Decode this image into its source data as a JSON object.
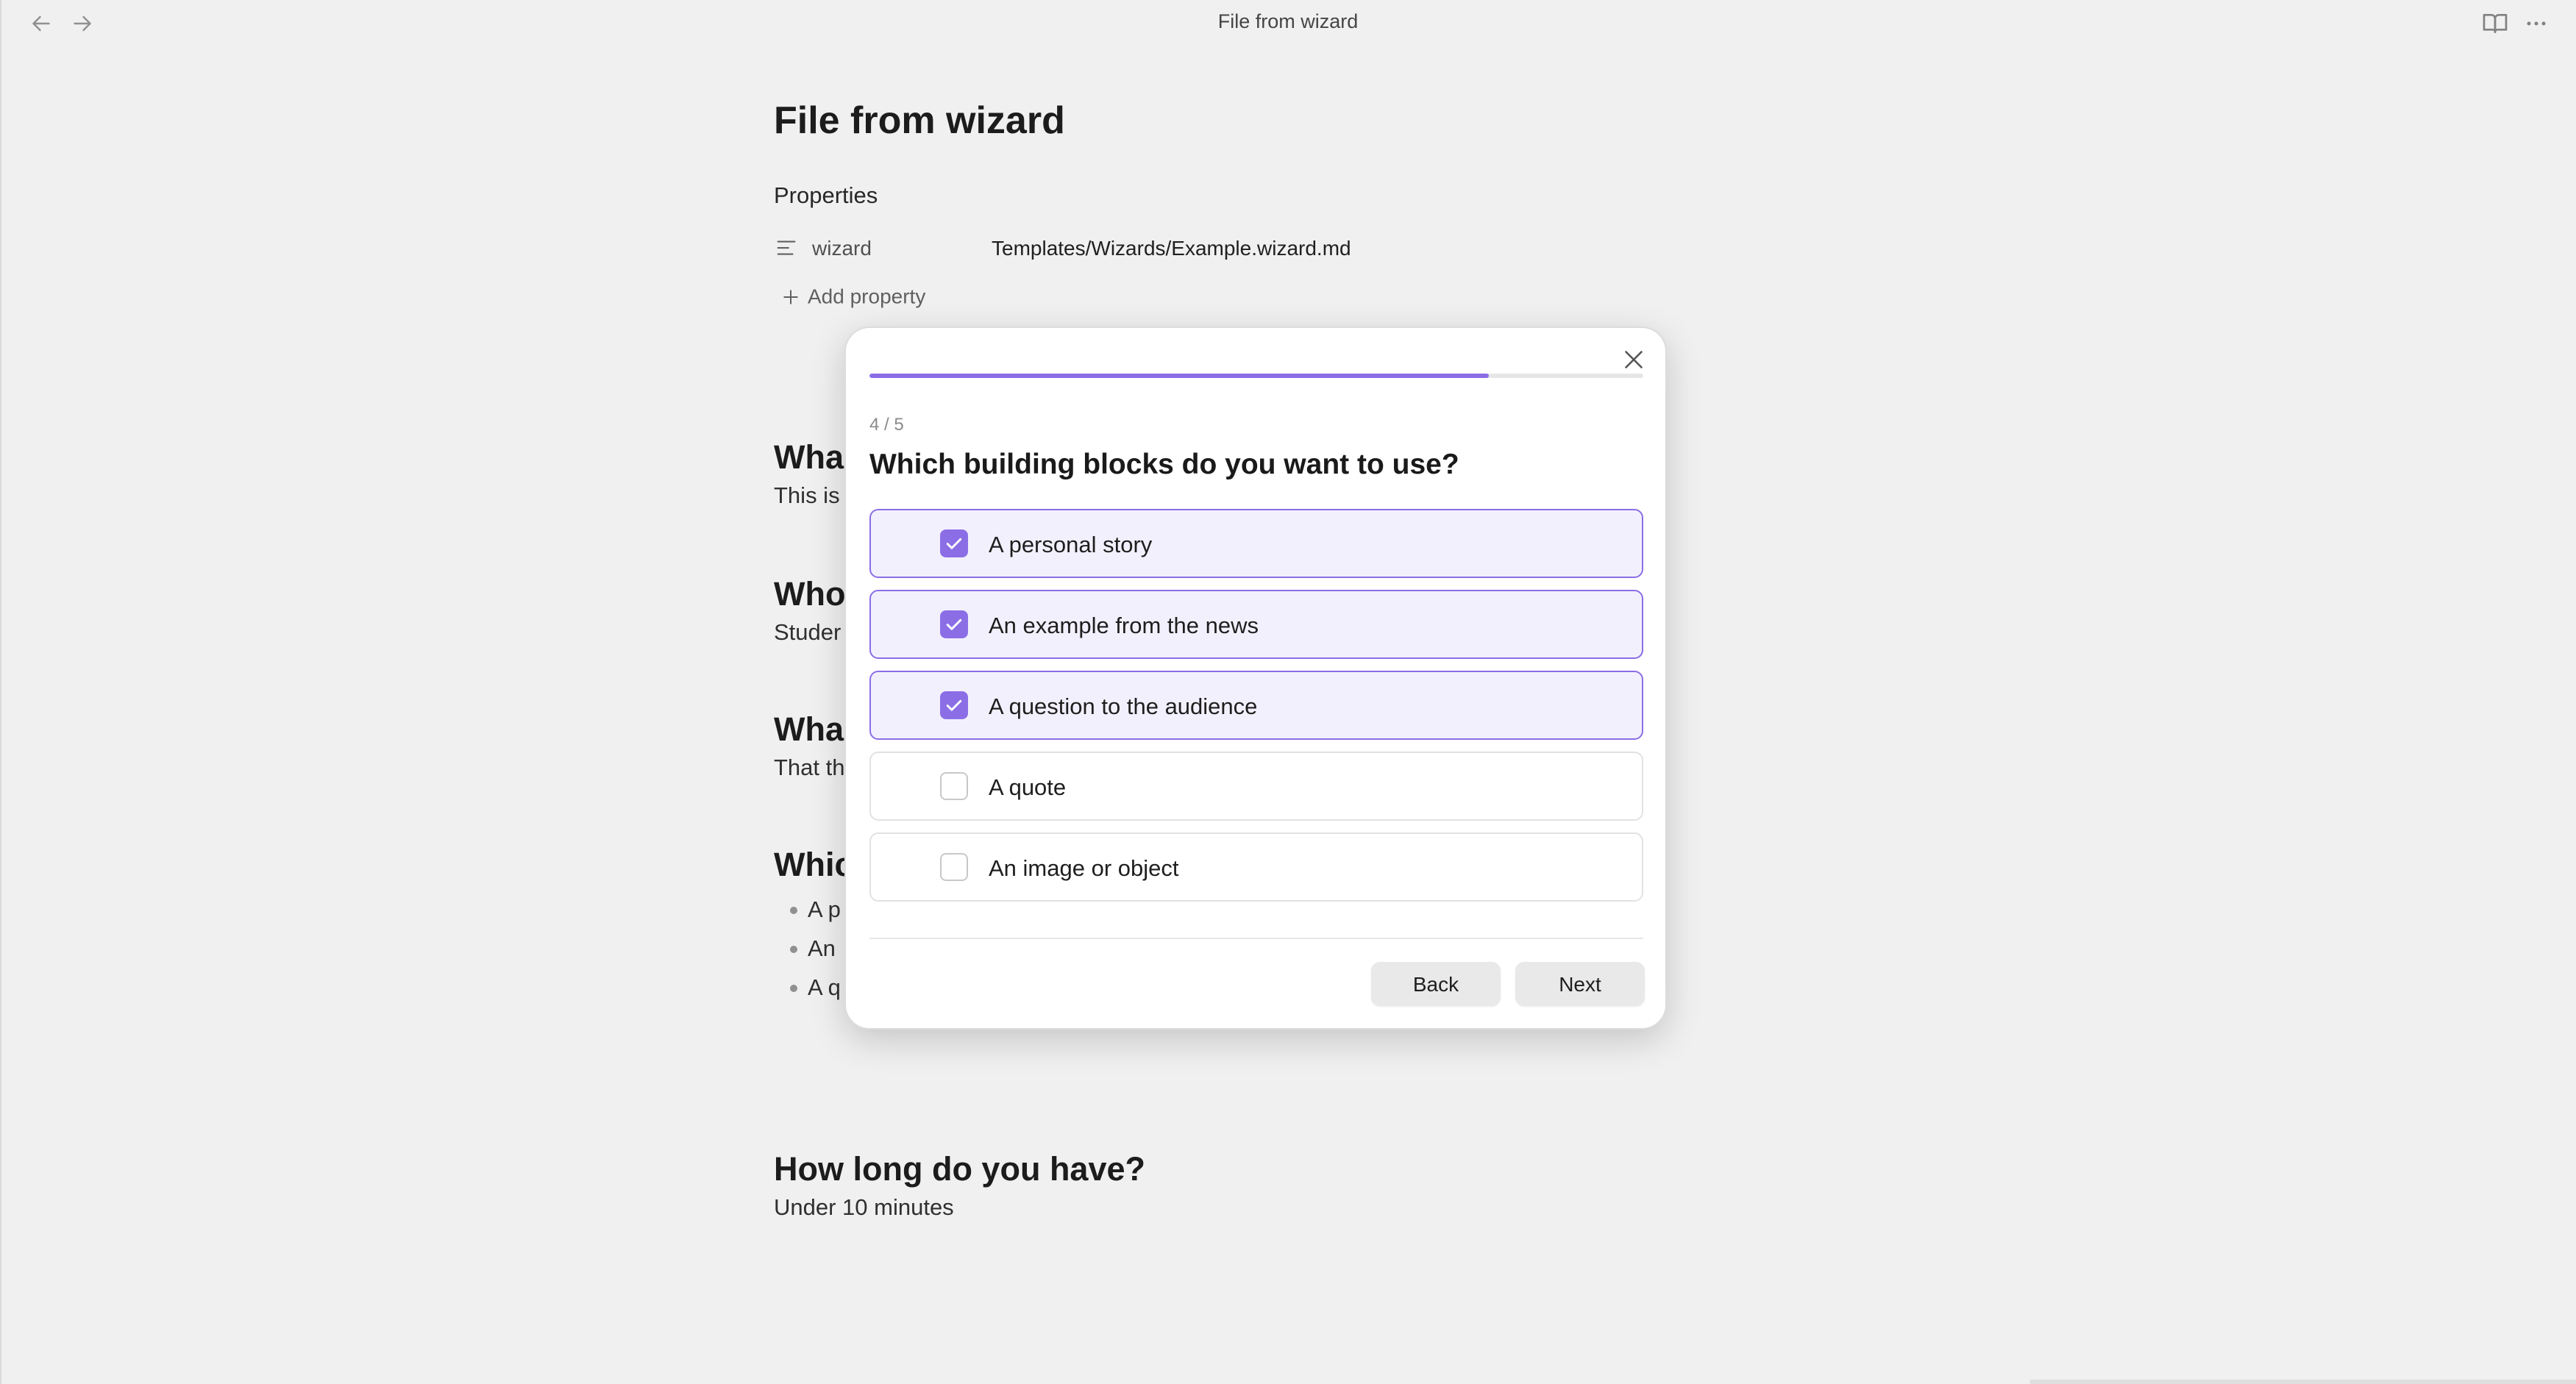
{
  "window": {
    "title": "File from wizard"
  },
  "icons": {
    "back": "arrow-left-icon",
    "forward": "arrow-right-icon",
    "reading_view": "book-open-icon",
    "more": "more-horizontal-icon",
    "property_type": "text-lines-icon",
    "add": "plus-icon",
    "close": "close-icon",
    "check": "check-icon"
  },
  "document": {
    "title": "File from wizard",
    "properties_heading": "Properties",
    "property": {
      "key": "wizard",
      "value": "Templates/Wizards/Example.wizard.md"
    },
    "add_property_label": "Add property",
    "sections": [
      {
        "heading": "Wha",
        "text": "This is"
      },
      {
        "heading": "Who",
        "text": "Studer"
      },
      {
        "heading": "Wha",
        "text": "That th"
      },
      {
        "heading": "Whic",
        "items": [
          "A p",
          "An",
          "A q"
        ]
      },
      {
        "heading": "How long do you have?",
        "text": "Under 10 minutes"
      }
    ]
  },
  "wizard": {
    "progress": {
      "current": 4,
      "total": 5,
      "fill_fraction": 0.8
    },
    "step_counter": "4 / 5",
    "question": "Which building blocks do you want to use?",
    "options": [
      {
        "label": "A personal story",
        "checked": true
      },
      {
        "label": "An example from the news",
        "checked": true
      },
      {
        "label": "A question to the audience",
        "checked": true
      },
      {
        "label": "A quote",
        "checked": false
      },
      {
        "label": "An image or object",
        "checked": false
      }
    ],
    "back_label": "Back",
    "next_label": "Next"
  },
  "colors": {
    "accent": "#8b6ee6",
    "selected_bg": "#f3f0fd",
    "button_bg": "#e9e9e9"
  }
}
